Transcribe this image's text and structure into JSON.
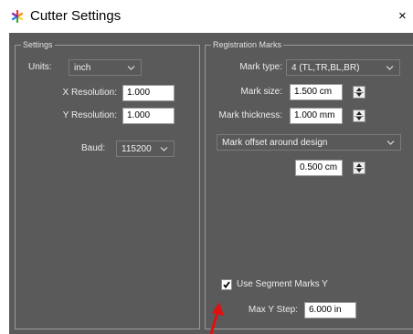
{
  "window": {
    "title": "Cutter Settings",
    "close_glyph": "×"
  },
  "settings": {
    "legend": "Settings",
    "units_label": "Units:",
    "units_value": "inch",
    "x_resolution_label": "X Resolution:",
    "x_resolution_value": "1.000",
    "y_resolution_label": "Y Resolution:",
    "y_resolution_value": "1.000",
    "baud_label": "Baud:",
    "baud_value": "115200"
  },
  "registration": {
    "legend": "Registration Marks",
    "mark_type_label": "Mark type:",
    "mark_type_value": "4 (TL,TR,BL,BR)",
    "mark_size_label": "Mark size:",
    "mark_size_value": "1.500 cm",
    "mark_thickness_label": "Mark thickness:",
    "mark_thickness_value": "1.000 mm",
    "offset_mode_value": "Mark offset around design",
    "offset_value": "0.500 cm",
    "segment_marks_label": "Use Segment Marks Y",
    "segment_marks_checked": true,
    "max_y_step_label": "Max Y Step:",
    "max_y_step_value": "6.000 in"
  },
  "colors": {
    "dialog_bg": "#5a5a5a",
    "annotation_arrow": "#e01010"
  }
}
